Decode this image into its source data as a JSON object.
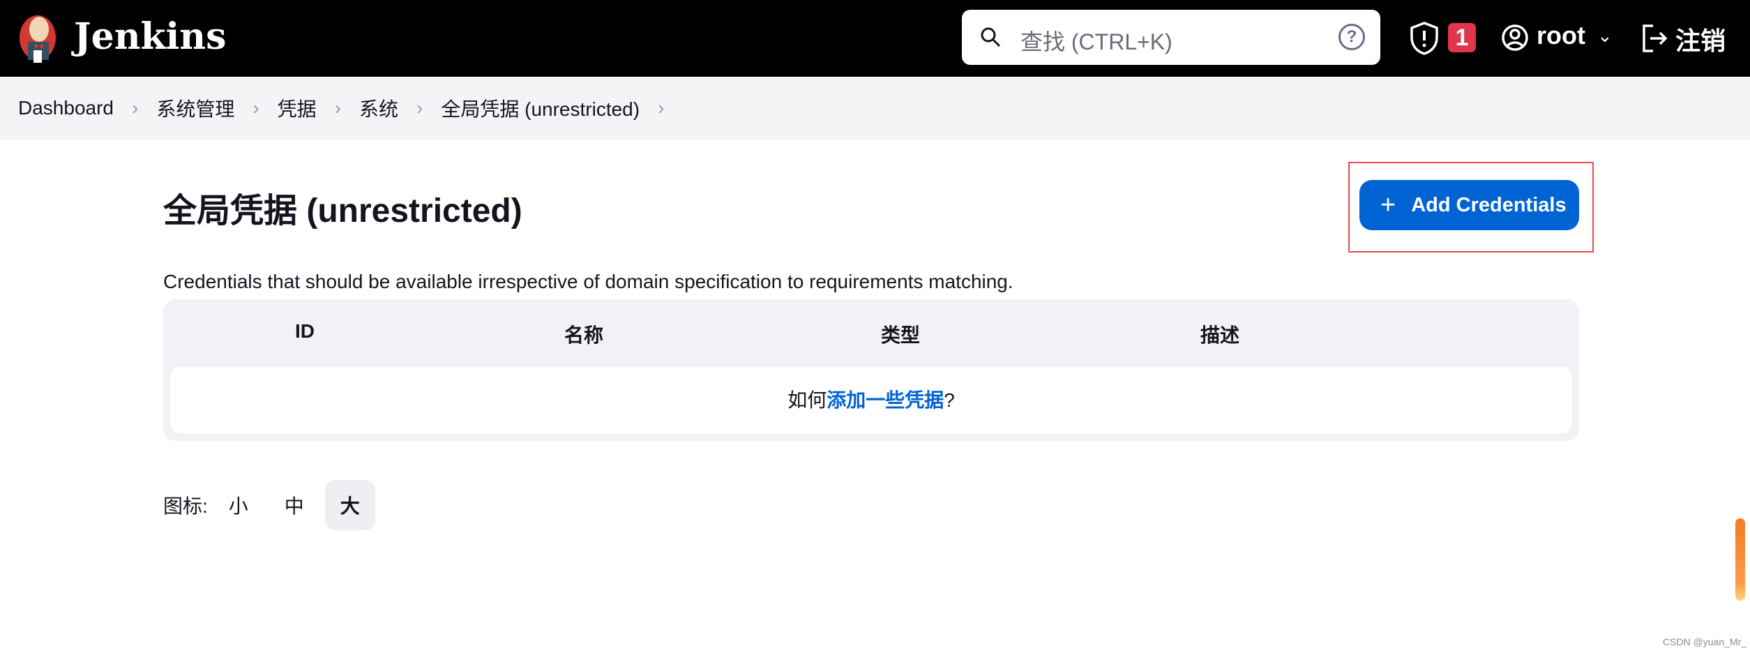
{
  "header": {
    "brand": "Jenkins",
    "search_placeholder": "查找 (CTRL+K)",
    "help": "?",
    "alerts_count": "1",
    "user": "root",
    "logout": "注销"
  },
  "breadcrumb": [
    "Dashboard",
    "系统管理",
    "凭据",
    "系统",
    "全局凭据 (unrestricted)"
  ],
  "main": {
    "title": "全局凭据 (unrestricted)",
    "add_button": "Add Credentials",
    "description": "Credentials that should be available irrespective of domain specification to requirements matching.",
    "table": {
      "columns": [
        "ID",
        "名称",
        "类型",
        "描述"
      ],
      "empty_prefix": "如何",
      "empty_link": "添加一些凭据",
      "empty_suffix": "?"
    },
    "icon_size": {
      "label": "图标:",
      "options": [
        "小",
        "中",
        "大"
      ],
      "selected": "大"
    }
  },
  "watermark": "CSDN @yuan_Mr_",
  "colors": {
    "accent": "#0063d3",
    "alert": "#e0354b"
  }
}
